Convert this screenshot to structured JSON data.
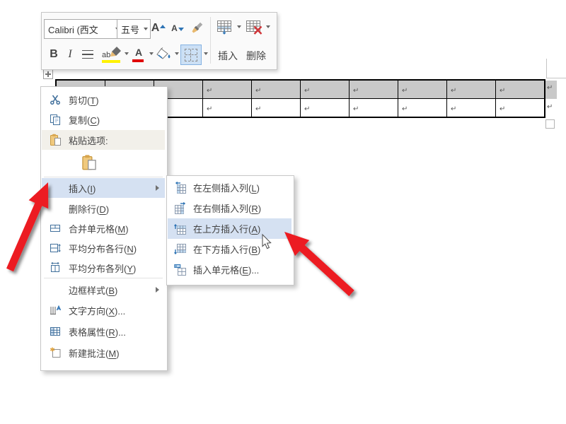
{
  "mini_toolbar": {
    "font_name": "Calibri (西文",
    "font_size": "五号",
    "bold": "B",
    "italic": "I",
    "highlight_letters": "ab",
    "font_color_letter": "A",
    "insert_label": "插入",
    "delete_label": "删除"
  },
  "context_menu": {
    "items": {
      "cut": {
        "pre": "剪切(",
        "key": "T",
        "post": ")"
      },
      "copy": {
        "pre": "复制(",
        "key": "C",
        "post": ")"
      },
      "paste_options": {
        "label": "粘贴选项:"
      },
      "insert": {
        "pre": "插入(",
        "key": "I",
        "post": ")",
        "highlighted": true,
        "has_submenu": true
      },
      "delete_row": {
        "pre": "删除行(",
        "key": "D",
        "post": ")"
      },
      "merge_cells": {
        "pre": "合并单元格(",
        "key": "M",
        "post": ")"
      },
      "distribute_rows": {
        "pre": "平均分布各行(",
        "key": "N",
        "post": ")"
      },
      "distribute_columns": {
        "pre": "平均分布各列(",
        "key": "Y",
        "post": ")"
      },
      "border_styles": {
        "pre": "边框样式(",
        "key": "B",
        "post": ")",
        "has_submenu": true
      },
      "text_direction": {
        "pre": "文字方向(",
        "key": "X",
        "post": ")..."
      },
      "table_properties": {
        "pre": "表格属性(",
        "key": "R",
        "post": ")..."
      },
      "new_comment": {
        "pre": "新建批注(",
        "key": "M",
        "post": ")"
      }
    }
  },
  "submenu": {
    "items": {
      "col_left": {
        "pre": "在左侧插入列(",
        "key": "L",
        "post": ")"
      },
      "col_right": {
        "pre": "在右侧插入列(",
        "key": "R",
        "post": ")"
      },
      "row_above": {
        "pre": "在上方插入行(",
        "key": "A",
        "post": ")",
        "highlighted": true
      },
      "row_below": {
        "pre": "在下方插入行(",
        "key": "B",
        "post": ")"
      },
      "cells": {
        "pre": "插入单元格(",
        "key": "E",
        "post": ")..."
      }
    }
  },
  "document_table": {
    "cell_marker": "↵",
    "columns": 10,
    "rows": 2,
    "selected_row": 1
  },
  "colors": {
    "menu_highlight": "#D5E1F2",
    "selected_row_bg": "#C9C9C9",
    "paste_label_bg": "#F2F0EA",
    "arrow_red": "#EC1C24",
    "highlight_yellow": "#FFF200",
    "font_color_red": "#E00000",
    "icon_blue": "#41709C",
    "accent_blue": "#2E74B5",
    "menu_text": "#444444",
    "menu_border": "#C8C8C8",
    "borders_button_bg": "#CCE0F5",
    "borders_button_border": "#85B2E2"
  },
  "icons": [
    "scissors-icon",
    "copy-icon",
    "clipboard-icon",
    "paste-option-icon",
    "merge-cells-icon",
    "distribute-rows-icon",
    "distribute-columns-icon",
    "text-direction-icon",
    "table-properties-icon",
    "new-comment-icon",
    "insert-column-left-icon",
    "insert-column-right-icon",
    "insert-row-above-icon",
    "insert-row-below-icon",
    "insert-cells-icon",
    "grow-font-icon",
    "shrink-font-icon",
    "format-painter-icon",
    "insert-table-icon",
    "delete-table-icon",
    "borders-icon",
    "shading-icon",
    "submenu-arrow-icon",
    "dropdown-caret-icon",
    "mouse-cursor",
    "red-arrow",
    "table-move-handle",
    "table-resize-handle"
  ]
}
